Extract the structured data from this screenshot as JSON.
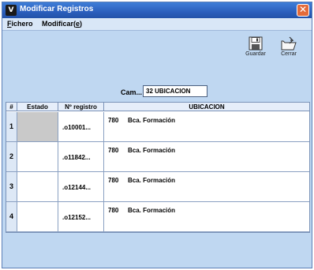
{
  "window": {
    "title": "Modificar Registros",
    "close_glyph": "✕"
  },
  "menu": {
    "fichero_u": "F",
    "fichero_rest": "ichero",
    "modificar_pre": "Modificar(",
    "modificar_u": "e",
    "modificar_post": ")"
  },
  "toolbar": {
    "guardar_label": "Guardar",
    "cerrar_label": "Cerrar"
  },
  "campo": {
    "label": "Cam...",
    "value": "32 UBICACION"
  },
  "table": {
    "headers": [
      "#",
      "Estado",
      "Nº registro",
      "UBICACION"
    ],
    "rows": [
      {
        "num": "1",
        "estado": "",
        "registro": ".o10001...",
        "ubic_code": "780",
        "ubic_desc": "Bca. Formación",
        "selected": true
      },
      {
        "num": "2",
        "estado": "",
        "registro": ".o11842...",
        "ubic_code": "780",
        "ubic_desc": "Bca. Formación",
        "selected": false
      },
      {
        "num": "3",
        "estado": "",
        "registro": ".o12144...",
        "ubic_code": "780",
        "ubic_desc": "Bca. Formación",
        "selected": false
      },
      {
        "num": "4",
        "estado": "",
        "registro": ".o12152...",
        "ubic_code": "780",
        "ubic_desc": "Bca. Formación",
        "selected": false
      }
    ]
  },
  "icons": {
    "app": "app-icon",
    "guardar": "floppy-disk-icon",
    "cerrar": "folder-close-icon"
  }
}
